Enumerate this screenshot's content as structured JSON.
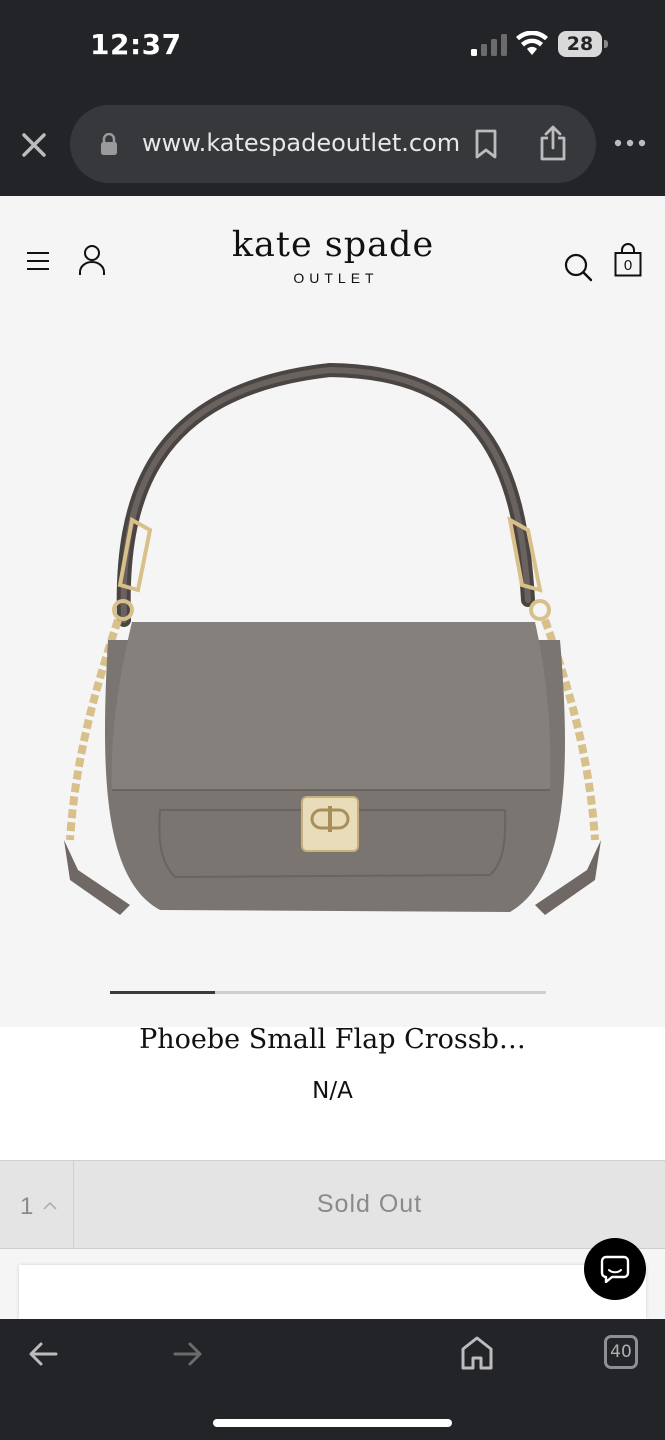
{
  "status_bar": {
    "time": "12:37",
    "battery": "28",
    "icons": [
      "signal-icon",
      "wifi-icon",
      "battery-icon"
    ]
  },
  "browser": {
    "url": "www.katespadeoutlet.com",
    "tab_count": "40",
    "icons": [
      "close-icon",
      "lock-icon",
      "bookmark-icon",
      "share-icon",
      "more-icon",
      "back-icon",
      "forward-icon",
      "home-icon",
      "tabs-icon"
    ]
  },
  "site_header": {
    "logo_main": "kate spade",
    "logo_sub": "OUTLET",
    "bag_count": "0",
    "icons": [
      "menu-icon",
      "account-icon",
      "search-icon",
      "bag-icon"
    ]
  },
  "product": {
    "title": "Phoebe Small Flap Crossb…",
    "price": "N/A",
    "carousel_progress": 0.24
  },
  "buy": {
    "quantity": "1",
    "button_label": "Sold Out"
  },
  "colors": {
    "browser_chrome": "#232427",
    "page_background": "#f6f5f5",
    "disabled_button": "#e4e4e4",
    "bag_leather": "#7b7571",
    "gold_hardware": "#d8c08a"
  }
}
